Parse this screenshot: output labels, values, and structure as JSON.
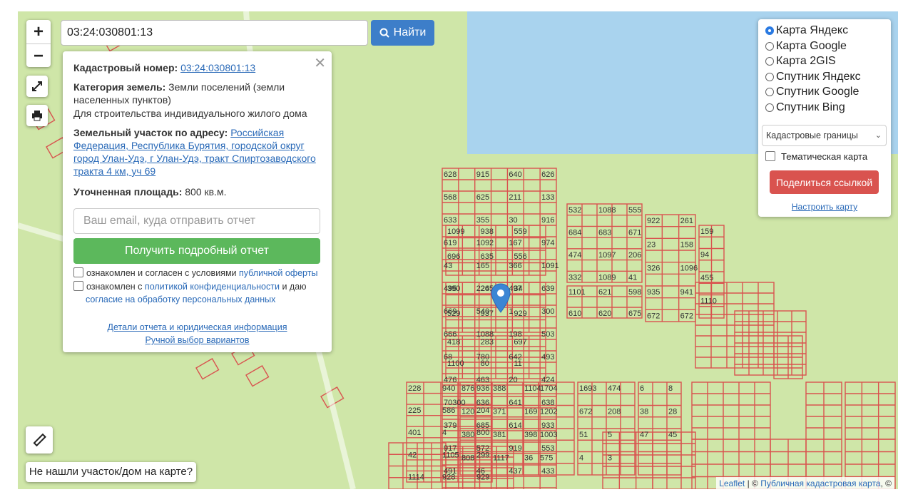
{
  "search": {
    "value": "03:24:030801:13",
    "button_label": "Найти"
  },
  "zoom": {
    "in": "+",
    "out": "−"
  },
  "popup": {
    "cad_label": "Кадастровый номер:",
    "cad_value": "03:24:030801:13",
    "category_label": "Категория земель:",
    "category_value": "Земли поселений (земли населенных пунктов)",
    "use_value": "Для строительства индивидуального жилого дома",
    "address_label": "Земельный участок по адресу:",
    "address_value": "Российская Федерация, Республика Бурятия, городской округ город Улан-Удэ, г Улан-Удэ, тракт Спиртозаводского тракта 4 км, уч 69",
    "area_label": "Уточненная площадь:",
    "area_value": "800 кв.м.",
    "email_placeholder": "Ваш email, куда отправить отчет",
    "report_button": "Получить подробный отчет",
    "agree1_text": "ознакомлен и согласен с условиями",
    "agree1_link": "публичной оферты",
    "agree2_text": "ознакомлен с",
    "agree2_link": "политикой конфиденциальности",
    "agree2_text2": "и даю",
    "agree2_link2": "согласие на обработку персональных данных",
    "details_link": "Детали отчета и юридическая информация",
    "manual_link": "Ручной выбор вариантов"
  },
  "layers": {
    "options": [
      "Карта Яндекс",
      "Карта Google",
      "Карта 2GIS",
      "Спутник Яндекс",
      "Спутник Google",
      "Спутник Bing"
    ],
    "selected": "Карта Яндекс",
    "overlay_select": "Кадастровые границы",
    "thematic_label": "Тематическая карта",
    "share_button": "Поделиться ссылкой",
    "setup_link": "Настроить карту"
  },
  "notfound": "Не нашли участок/дом на карте?",
  "attribution": {
    "leaflet": "Leaflet",
    "sep": " | © ",
    "pkk": "Публичная кадастровая карта",
    "tail": ", ©"
  },
  "map_labels": [
    "628",
    "915",
    "640",
    "626",
    "568",
    "625",
    "211",
    "133",
    "633",
    "355",
    "30",
    "916",
    "619",
    "1092",
    "167",
    "974",
    "43",
    "165",
    "366",
    "1091",
    "495",
    "224",
    "497",
    "639",
    "669",
    "540",
    "1",
    "300",
    "666",
    "1088",
    "198",
    "503",
    "68",
    "780",
    "642",
    "493",
    "476",
    "463",
    "20",
    "424",
    "70300",
    "636",
    "641",
    "638",
    "379",
    "685",
    "614",
    "933",
    "917",
    "572",
    "919",
    "553",
    "491",
    "46",
    "437",
    "433",
    "509",
    "561",
    "240",
    "637",
    "532",
    "1088",
    "555",
    "684",
    "683",
    "671",
    "474",
    "1097",
    "206",
    "332",
    "1089",
    "41",
    "1101",
    "621",
    "598",
    "610",
    "620",
    "675",
    "922",
    "261",
    "23",
    "158",
    "326",
    "1096",
    "935",
    "941",
    "672",
    "672",
    "159",
    "94",
    "455",
    "1110",
    "1099",
    "938",
    "559",
    "696",
    "635",
    "556",
    "390",
    "265",
    "34",
    "529",
    "937",
    "929",
    "418",
    "283",
    "697",
    "1100",
    "80",
    "11",
    "228",
    "940",
    "936",
    "225",
    "586",
    "204",
    "401",
    "4",
    "800",
    "42",
    "1105",
    "299",
    "1114",
    "928",
    "929",
    "876",
    "388",
    "1104",
    "120",
    "371",
    "169",
    "380",
    "381",
    "398",
    "808",
    "1117",
    "36",
    "1704",
    "1202",
    "1003",
    "575",
    "1693",
    "474",
    "672",
    "208",
    "51",
    "5",
    "4",
    "3",
    "6",
    "8",
    "38",
    "28",
    "47",
    "45"
  ],
  "marker": "location-marker"
}
